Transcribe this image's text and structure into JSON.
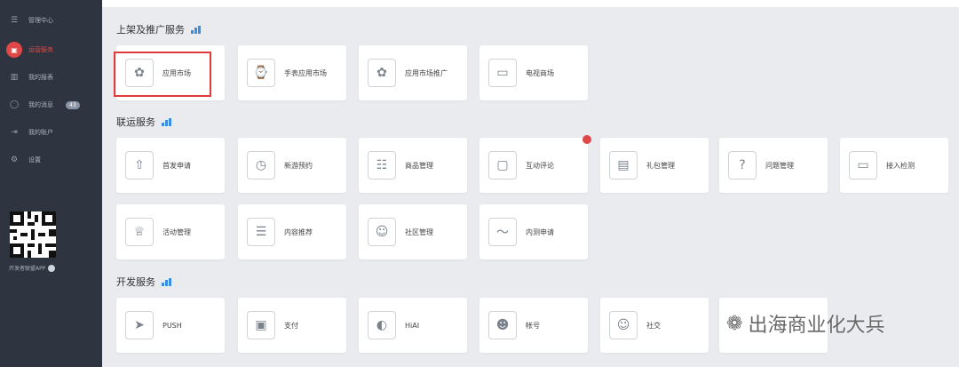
{
  "sidebar": {
    "items": [
      {
        "label": "管理中心",
        "icon": "grid-icon"
      },
      {
        "label": "运营服务",
        "icon": "service-icon"
      },
      {
        "label": "我的报表",
        "icon": "chart-icon"
      },
      {
        "label": "我的消息",
        "icon": "message-icon",
        "badge": "43"
      },
      {
        "label": "我的账户",
        "icon": "account-icon"
      },
      {
        "label": "设置",
        "icon": "settings-icon"
      }
    ],
    "qr_label": "开发者联盟APP",
    "colors": {
      "background": "#2f3540",
      "active": "#e04848"
    }
  },
  "sections": {
    "listing": {
      "title": "上架及推广服务",
      "tiles": [
        {
          "label": "应用市场",
          "icon": "huawei-app-market-icon"
        },
        {
          "label": "手表应用市场",
          "icon": "watch-icon"
        },
        {
          "label": "应用市场推广",
          "icon": "huawei-promotion-icon"
        },
        {
          "label": "电视商场",
          "icon": "tv-store-icon"
        }
      ]
    },
    "operations": {
      "title": "联运服务",
      "tiles": [
        {
          "label": "首发申请",
          "icon": "rocket-icon"
        },
        {
          "label": "新游预约",
          "icon": "clock-icon"
        },
        {
          "label": "商品管理",
          "icon": "clipboard-icon"
        },
        {
          "label": "互动评论",
          "icon": "comment-icon"
        },
        {
          "label": "礼包管理",
          "icon": "gift-icon"
        },
        {
          "label": "问题管理",
          "icon": "question-icon"
        },
        {
          "label": "接入检测",
          "icon": "monitor-icon"
        },
        {
          "label": "活动管理",
          "icon": "trophy-icon"
        },
        {
          "label": "内容推荐",
          "icon": "content-icon"
        },
        {
          "label": "社区管理",
          "icon": "community-icon"
        },
        {
          "label": "内测申请",
          "icon": "beta-icon"
        }
      ]
    },
    "dev": {
      "title": "开发服务",
      "tiles": [
        {
          "label": "PUSH",
          "icon": "paper-plane-icon"
        },
        {
          "label": "支付",
          "icon": "wallet-icon"
        },
        {
          "label": "HiAI",
          "icon": "hiai-icon"
        },
        {
          "label": "帐号",
          "icon": "user-icon"
        },
        {
          "label": "社交",
          "icon": "social-icon"
        },
        {
          "label": "",
          "icon": "blank-icon"
        }
      ]
    }
  },
  "watermark": {
    "text": "出海商业化大兵",
    "icon": "wechat-icon"
  },
  "colors": {
    "highlight": "#e03a3a",
    "accent_blue": "#3b8ee0"
  }
}
